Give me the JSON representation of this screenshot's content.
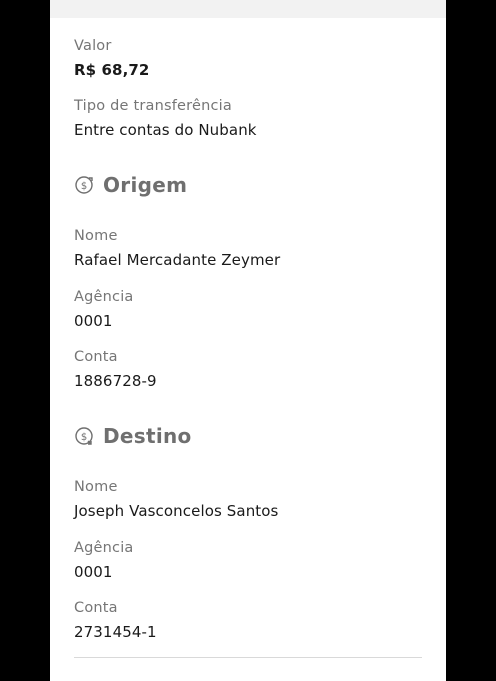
{
  "summary": {
    "valor_label": "Valor",
    "valor_value": "R$ 68,72",
    "tipo_label": "Tipo de transferência",
    "tipo_value": "Entre contas do Nubank"
  },
  "origem": {
    "title": "Origem",
    "icon": "money-transfer-icon",
    "nome_label": "Nome",
    "nome_value": "Rafael Mercadante Zeymer",
    "agencia_label": "Agência",
    "agencia_value": "0001",
    "conta_label": "Conta",
    "conta_value": "1886728-9"
  },
  "destino": {
    "title": "Destino",
    "icon": "money-received-icon",
    "nome_label": "Nome",
    "nome_value": "Joseph Vasconcelos Santos",
    "agencia_label": "Agência",
    "agencia_value": "0001",
    "conta_label": "Conta",
    "conta_value": "2731454-1"
  },
  "colors": {
    "label": "#767676",
    "value": "#1a1a1a",
    "section_title": "#6f6f6f",
    "divider": "#d9d9d9"
  }
}
